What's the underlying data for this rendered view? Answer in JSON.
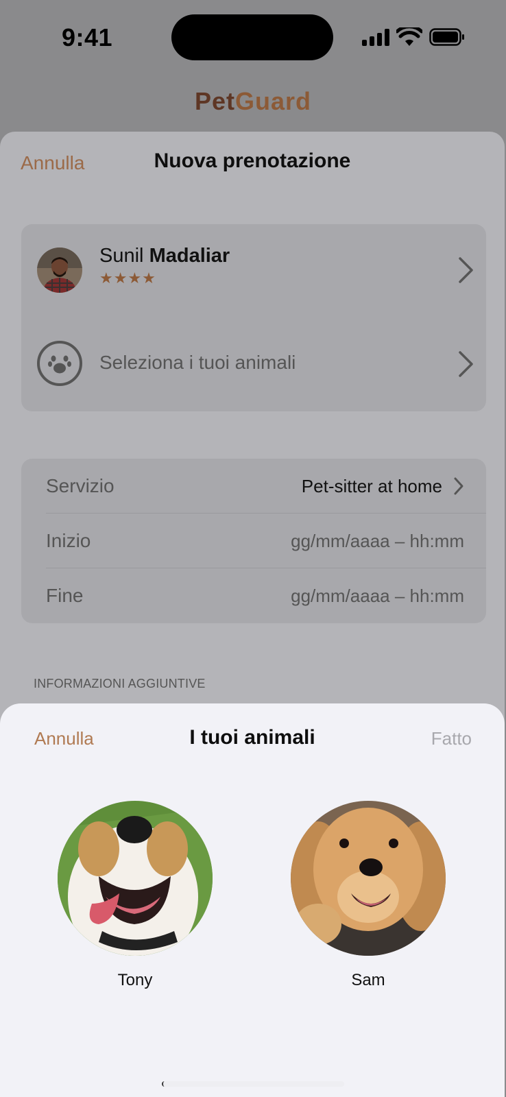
{
  "status_bar": {
    "time": "9:41"
  },
  "app": {
    "name_part1": "Pet",
    "name_part2": "Guard"
  },
  "booking_sheet": {
    "cancel_label": "Annulla",
    "title": "Nuova prenotazione",
    "sitter": {
      "first_name": "Sunil",
      "last_name": "Madaliar",
      "stars": "★★★★",
      "rating": 4
    },
    "pets_row_label": "Seleziona i tuoi animali",
    "rows": [
      {
        "label": "Servizio",
        "value": "Pet-sitter at home"
      },
      {
        "label": "Inizio",
        "value": "gg/mm/aaaa  –  hh:mm"
      },
      {
        "label": "Fine",
        "value": "gg/mm/aaaa  –  hh:mm"
      }
    ],
    "section_header": "INFORMAZIONI AGGIUNTIVE"
  },
  "pets_sheet": {
    "cancel_label": "Annulla",
    "title": "I tuoi animali",
    "done_label": "Fatto",
    "pets": [
      {
        "name": "Tony"
      },
      {
        "name": "Sam"
      }
    ]
  },
  "colors": {
    "accent": "#b07a52",
    "brand_dark": "#5e3624",
    "brand_light": "#8c5a36",
    "overlay": "#8a8a8c",
    "sheet": "#f2f2f7"
  }
}
